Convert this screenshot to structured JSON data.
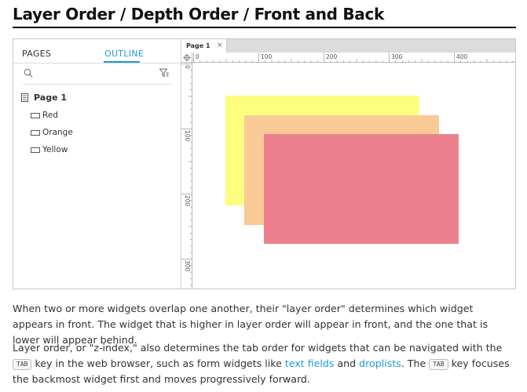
{
  "heading": "Layer Order / Depth Order / Front and Back",
  "left_panel": {
    "tabs": {
      "pages": "PAGES",
      "outline": "OUTLINE"
    },
    "search_icon": "search-icon",
    "filter_icon": "filter-icon",
    "tree": {
      "page": "Page 1",
      "items": [
        "Red",
        "Orange",
        "Yellow"
      ]
    }
  },
  "editor": {
    "tab_label": "Page 1",
    "tab_close": "×",
    "h_ruler": [
      "0",
      "100",
      "200",
      "300",
      "400"
    ],
    "v_ruler": [
      "0",
      "100",
      "200",
      "300"
    ],
    "widgets": [
      {
        "name": "Yellow",
        "color": "#fdfd7f"
      },
      {
        "name": "Orange",
        "color": "#f9ca95"
      },
      {
        "name": "Red",
        "color": "#ec808d"
      }
    ]
  },
  "text": {
    "p1": "When two or more widgets overlap one another, their \"layer order\" determines which widget appears in front. The widget that is higher in layer order will appear in front, and the one that is lower will appear behind.",
    "p2_a": "Layer order, or \"z-index,\" also determines the tab order for widgets that can be navigated with the ",
    "kbd1": "TAB",
    "p2_b": " key in the web browser, such as form widgets like ",
    "link1": "text fields",
    "p2_c": " and ",
    "link2": "droplists",
    "p2_d": ". The ",
    "kbd2": "TAB",
    "p2_e": " key focuses the backmost widget first and moves progressively forward."
  }
}
